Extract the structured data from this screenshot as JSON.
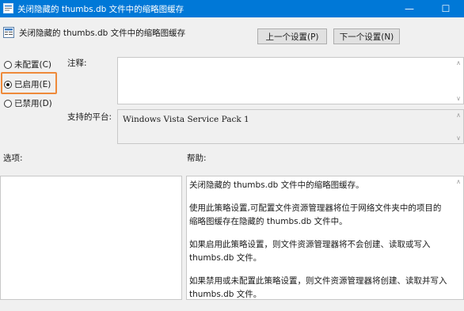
{
  "window": {
    "title": "关闭隐藏的 thumbs.db 文件中的缩略图缓存",
    "minimize_glyph": "—",
    "maximize_glyph": "☐"
  },
  "header": {
    "title": "关闭隐藏的 thumbs.db 文件中的缩略图缓存",
    "prev_button": "上一个设置(P)",
    "next_button": "下一个设置(N)"
  },
  "state": {
    "options": [
      {
        "label": "未配置(C)",
        "checked": false
      },
      {
        "label": "已启用(E)",
        "checked": true
      },
      {
        "label": "已禁用(D)",
        "checked": false
      }
    ]
  },
  "comment": {
    "label": "注释:",
    "value": ""
  },
  "platform": {
    "label": "支持的平台:",
    "value": "Windows Vista Service Pack 1"
  },
  "options_label": "选项:",
  "help": {
    "label": "帮助:",
    "paragraphs": [
      "关闭隐藏的 thumbs.db 文件中的缩略图缓存。",
      "使用此策略设置,可配置文件资源管理器将位于网络文件夹中的项目的缩略图缓存在隐藏的 thumbs.db 文件中。",
      "如果启用此策略设置，则文件资源管理器将不会创建、读取或写入 thumbs.db 文件。",
      "如果禁用或未配置此策略设置，则文件资源管理器将创建、读取并写入 thumbs.db 文件。"
    ]
  },
  "colors": {
    "titlebar": "#0078d7",
    "highlight": "#ee8a3a"
  }
}
